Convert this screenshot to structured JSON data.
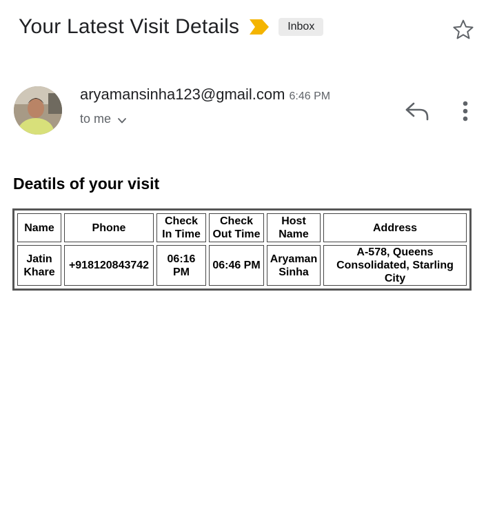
{
  "header": {
    "subject": "Your Latest Visit Details",
    "label": "Inbox",
    "important_color": "#f4b400"
  },
  "message": {
    "sender_email": "aryamansinha123@gmail.com",
    "time": "6:46 PM",
    "recipient": "to me"
  },
  "body": {
    "heading": "Deatils of your visit",
    "table": {
      "headers": [
        "Name",
        "Phone",
        "Check In Time",
        "Check Out Time",
        "Host Name",
        "Address"
      ],
      "rows": [
        [
          "Jatin Khare",
          "+918120843742",
          "06:16 PM",
          "06:46 PM",
          "Aryaman Sinha",
          "A-578, Queens Consolidated, Starling City"
        ]
      ]
    }
  },
  "icons": {
    "important": "important-marker-icon",
    "star": "star-outline-icon",
    "reply": "reply-icon",
    "more": "more-vertical-icon",
    "recipient_details": "chevron-down-icon"
  }
}
